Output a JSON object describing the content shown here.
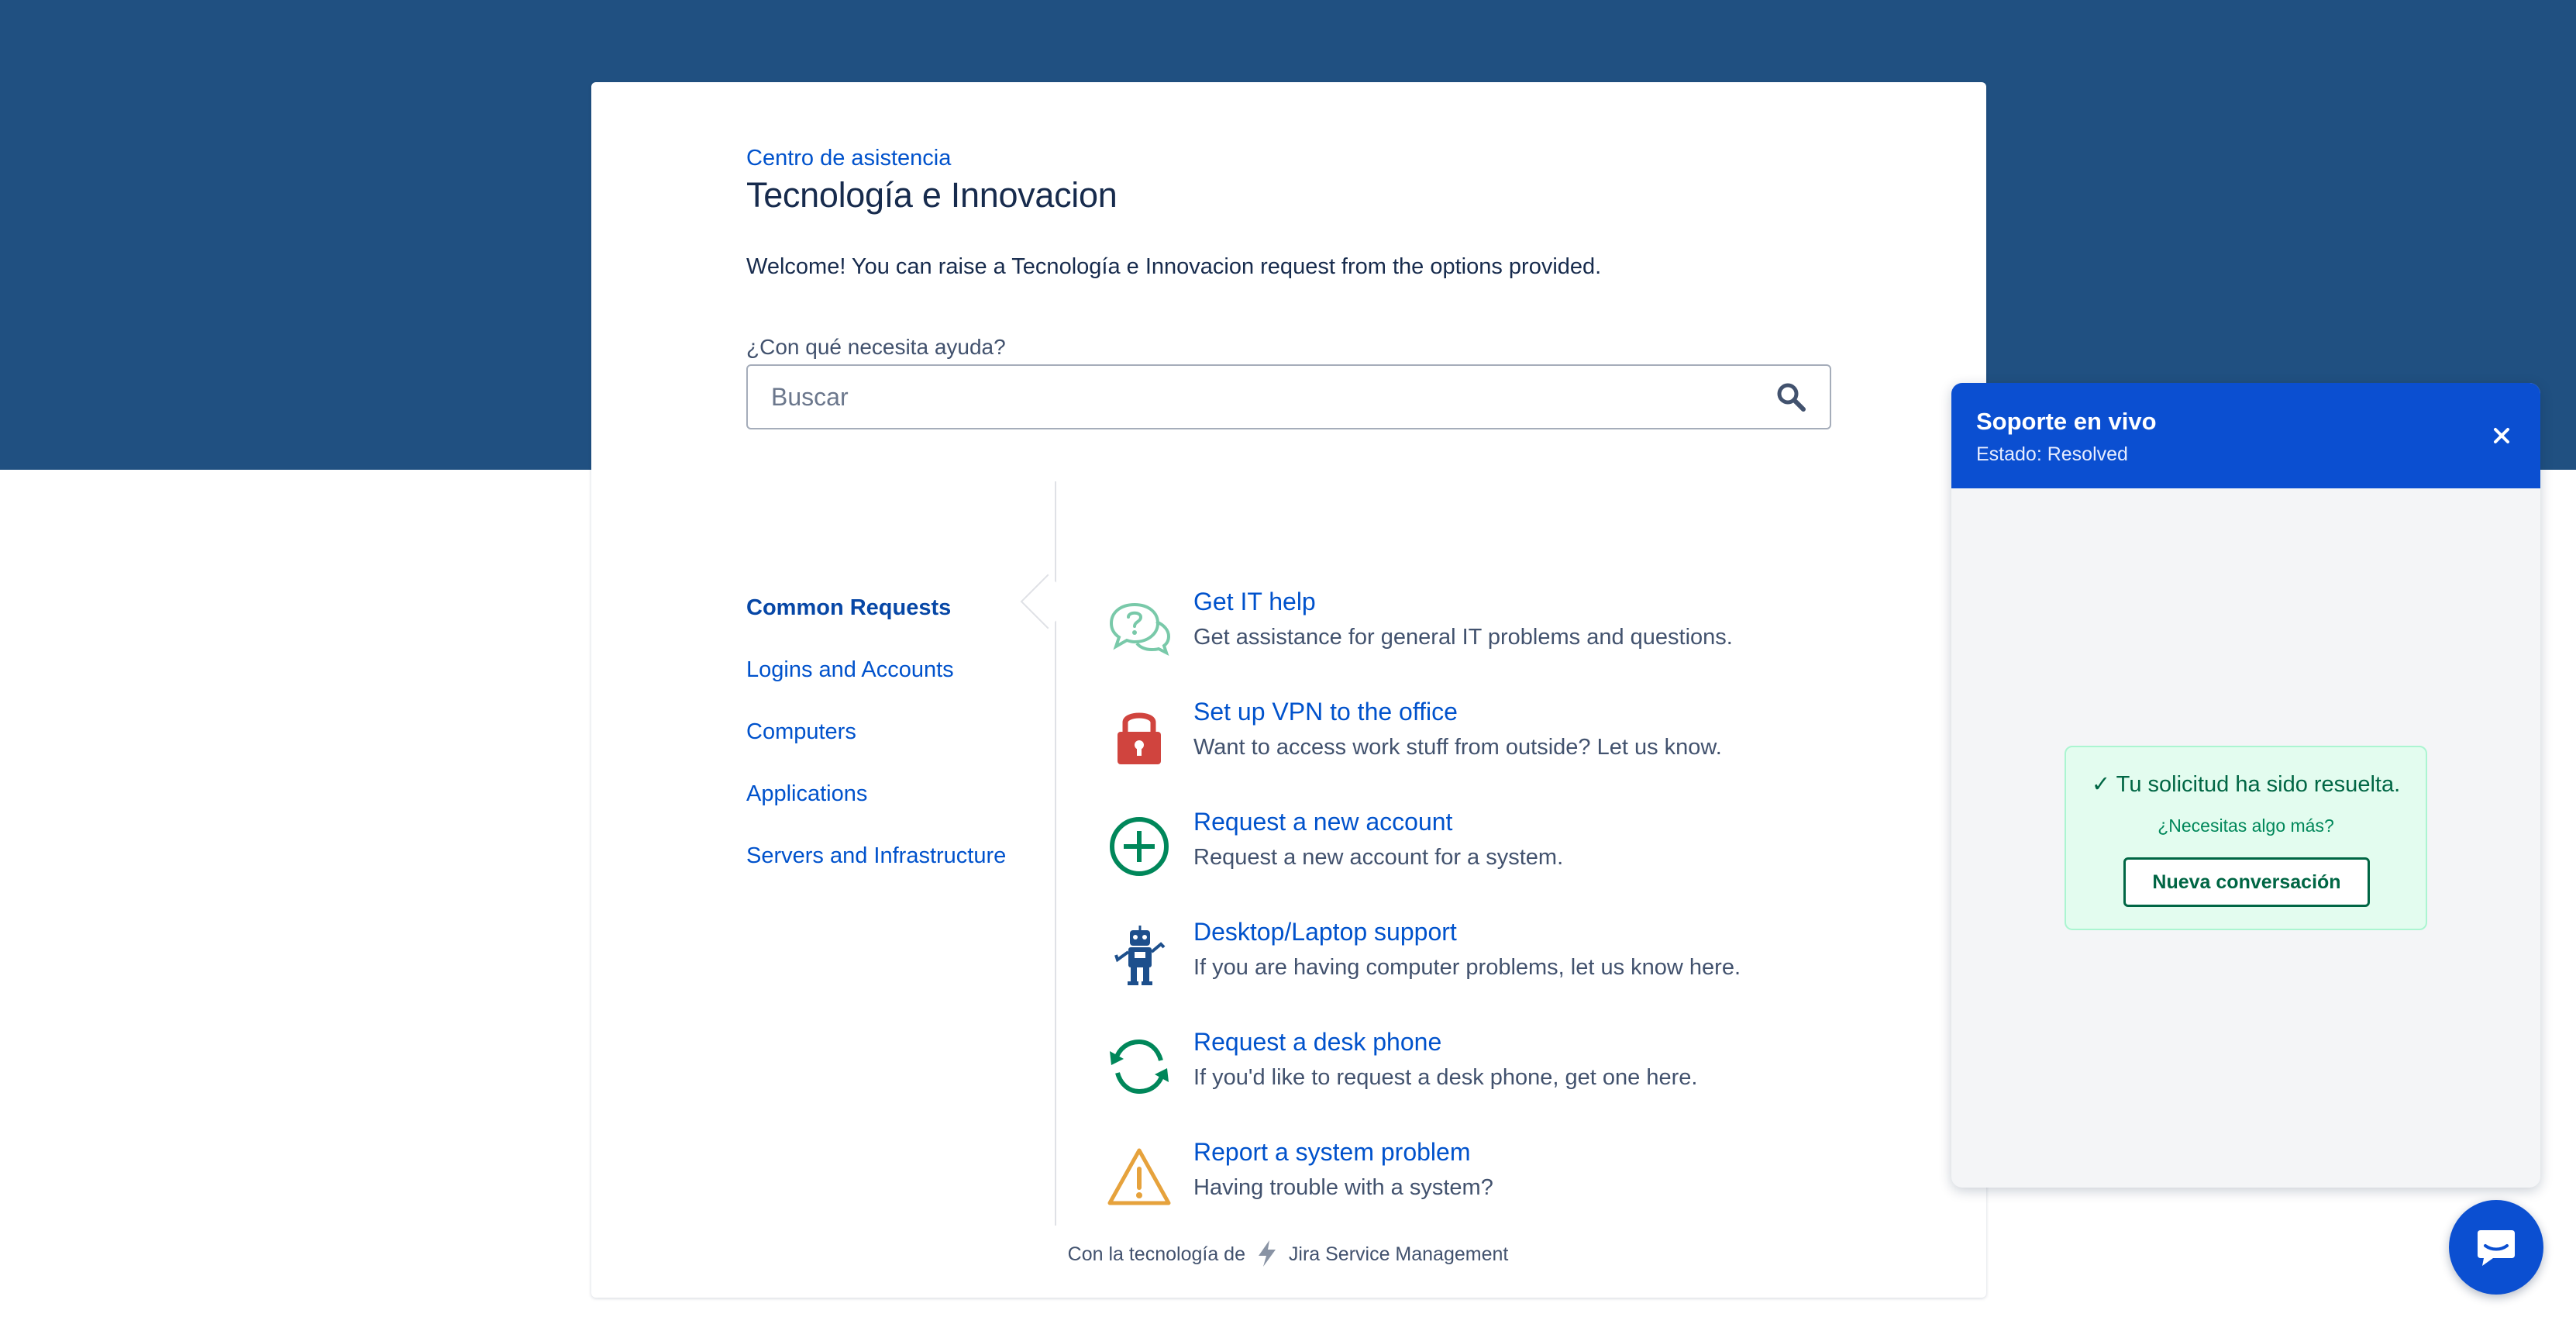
{
  "portal": {
    "breadcrumb": "Centro de asistencia",
    "title": "Tecnología e Innovacion",
    "welcome": "Welcome! You can raise a Tecnología e Innovacion request from the options provided."
  },
  "search": {
    "label": "¿Con qué necesita ayuda?",
    "placeholder": "Buscar",
    "value": ""
  },
  "categories": [
    {
      "label": "Common Requests",
      "active": true
    },
    {
      "label": "Logins and Accounts"
    },
    {
      "label": "Computers"
    },
    {
      "label": "Applications"
    },
    {
      "label": "Servers and Infrastructure"
    }
  ],
  "requests": [
    {
      "title": "Get IT help",
      "description": "Get assistance for general IT problems and questions.",
      "icon": "question-bubbles-icon"
    },
    {
      "title": "Set up VPN to the office",
      "description": "Want to access work stuff from outside? Let us know.",
      "icon": "lock-icon"
    },
    {
      "title": "Request a new account",
      "description": "Request a new account for a system.",
      "icon": "plus-circle-icon"
    },
    {
      "title": "Desktop/Laptop support",
      "description": "If you are having computer problems, let us know here.",
      "icon": "robot-icon"
    },
    {
      "title": "Request a desk phone",
      "description": "If you'd like to request a desk phone, get one here.",
      "icon": "refresh-arrows-icon"
    },
    {
      "title": "Report a system problem",
      "description": "Having trouble with a system?",
      "icon": "warning-triangle-icon"
    }
  ],
  "footer": {
    "prefix": "Con la tecnología de",
    "product": "Jira Service Management"
  },
  "chat": {
    "title": "Soporte en vivo",
    "status": "Estado: Resolved",
    "resolved_message": "✓ Tu solicitud ha sido resuelta.",
    "follow_up": "¿Necesitas algo más?",
    "new_conversation_label": "Nueva conversación"
  },
  "colors": {
    "hero": "#205081",
    "link": "#0052cc",
    "chat_header": "#0b4fd1",
    "resolved_bg": "#e3fcef",
    "resolved_text": "#006644"
  }
}
